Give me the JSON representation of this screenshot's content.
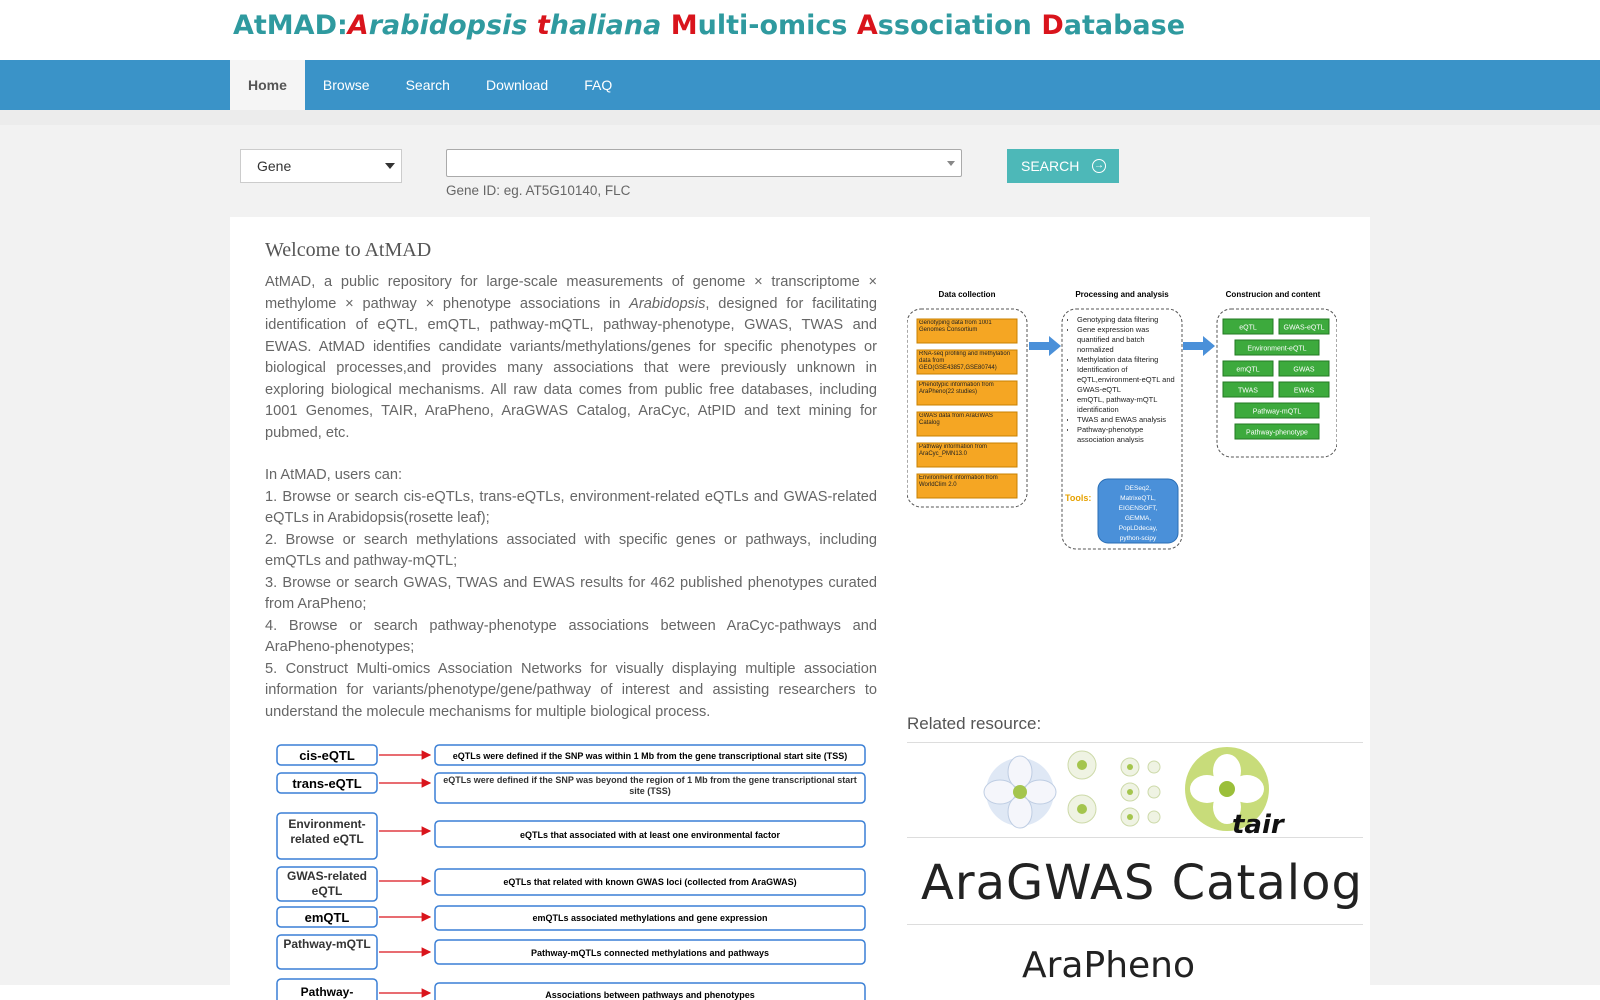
{
  "logo": {
    "p1": "AtMAD:",
    "p2": "A",
    "p3": "rabidopsis ",
    "p4": "t",
    "p5": "haliana ",
    "p6": "M",
    "p7": "ulti-omics ",
    "p8": "A",
    "p9": "ssociation ",
    "p10": "D",
    "p11": "atabase"
  },
  "nav": {
    "items": [
      "Home",
      "Browse",
      "Search",
      "Download",
      "FAQ"
    ],
    "active": "Home"
  },
  "search": {
    "type_selected": "Gene",
    "query_value": "",
    "hint": "Gene ID: eg. AT5G10140, FLC",
    "button_label": "SEARCH"
  },
  "welcome": {
    "title": "Welcome to AtMAD",
    "intro_a": "AtMAD, a public repository for large-scale measurements of genome × transcriptome × methylome × pathway × phenotype associations in ",
    "intro_italic": "Arabidopsis",
    "intro_b": ", designed for facilitating identification of eQTL, emQTL, pathway-mQTL, pathway-phenotype, GWAS, TWAS and EWAS. AtMAD identifies candidate variants/methylations/genes for specific phenotypes or biological processes,and provides many associations that were previously unknown in exploring biological mechanisms. All raw data comes from public free databases, including 1001 Genomes, TAIR, AraPheno, AraGWAS Catalog, AraCyc, AtPID and text mining for pubmed, etc.",
    "users_can": "In AtMAD, users can:",
    "items": [
      "1. Browse or search cis-eQTLs, trans-eQTLs, environment-related eQTLs and GWAS-related eQTLs in Arabidopsis(rosette leaf);",
      "2. Browse or search methylations associated with specific genes or pathways, including emQTLs and pathway-mQTL;",
      "3. Browse or search GWAS, TWAS and EWAS results for 462 published phenotypes curated from AraPheno;",
      "4. Browse or search pathway-phenotype associations between AraCyc-pathways and AraPheno-phenotypes;",
      "5. Construct Multi-omics Association Networks for visually displaying multiple association information for variants/phenotype/gene/pathway of interest and assisting researchers to understand the molecule mechanisms for multiple biological process."
    ]
  },
  "definitions": [
    {
      "term": "cis-eQTL",
      "desc": "eQTLs were defined if the SNP was within 1 Mb from the gene transcriptional start site (TSS)"
    },
    {
      "term": "trans-eQTL",
      "desc": "eQTLs were defined if the SNP was beyond the region of 1 Mb from the gene transcriptional start site (TSS)"
    },
    {
      "term": "Environment-related eQTL",
      "desc": "eQTLs that associated with at least one environmental factor"
    },
    {
      "term": "GWAS-related eQTL",
      "desc": "eQTLs that related with known GWAS loci (collected from AraGWAS)"
    },
    {
      "term": "emQTL",
      "desc": "emQTLs associated methylations and gene expression"
    },
    {
      "term": "Pathway-mQTL",
      "desc": "Pathway-mQTLs connected methylations and pathways"
    },
    {
      "term": "Pathway-",
      "desc": "Associations between pathways and phenotypes"
    }
  ],
  "workflow": {
    "col1_title": "Data collection",
    "col2_title": "Processing and analysis",
    "col3_title": "Construcion and content",
    "col1_items": [
      "Genotyping data from 1001 Genomes Consortium",
      "RNA-seq profiling and methylation data from GEO(GSE43857,GSE80744)",
      "Phenotypic information from AraPheno(22 studies)",
      "GWAS data from AraGWAS Catalog",
      "Pathway information from AraCyc_PMN13.0",
      "Environment information from WorldClim 2.0"
    ],
    "col2_items": [
      "Genotyping data filtering",
      "Gene expression was quantified and batch normalized",
      "Methylation data filtering",
      "Identification of eQTL,environment-eQTL and GWAS-eQTL",
      "emQTL, pathway-mQTL identification",
      "TWAS and EWAS analysis",
      "Pathway-phenotype association analysis"
    ],
    "tools_label": "Tools:",
    "tools": [
      "DESeq2,",
      "MatrixeQTL,",
      "EIGENSOFT,",
      "GEMMA,",
      "PopLDdecay,",
      "python-scipy"
    ],
    "col3_items": [
      "eQTL",
      "GWAS-eQTL",
      "Environment-eQTL",
      "emQTL",
      "GWAS",
      "TWAS",
      "EWAS",
      "Pathway-mQTL",
      "Pathway-phenotype"
    ]
  },
  "related": {
    "title": "Related resource:",
    "tair": "tair",
    "aragwas": "AraGWAS Catalog",
    "arapheno": "AraPheno"
  },
  "colors": {
    "nav": "#3a93c8",
    "logo_teal": "#2f9a9f",
    "logo_red": "#d9141c",
    "button": "#4db8b8",
    "workflow_orange": "#f5a623",
    "workflow_green": "#3daa3d"
  }
}
